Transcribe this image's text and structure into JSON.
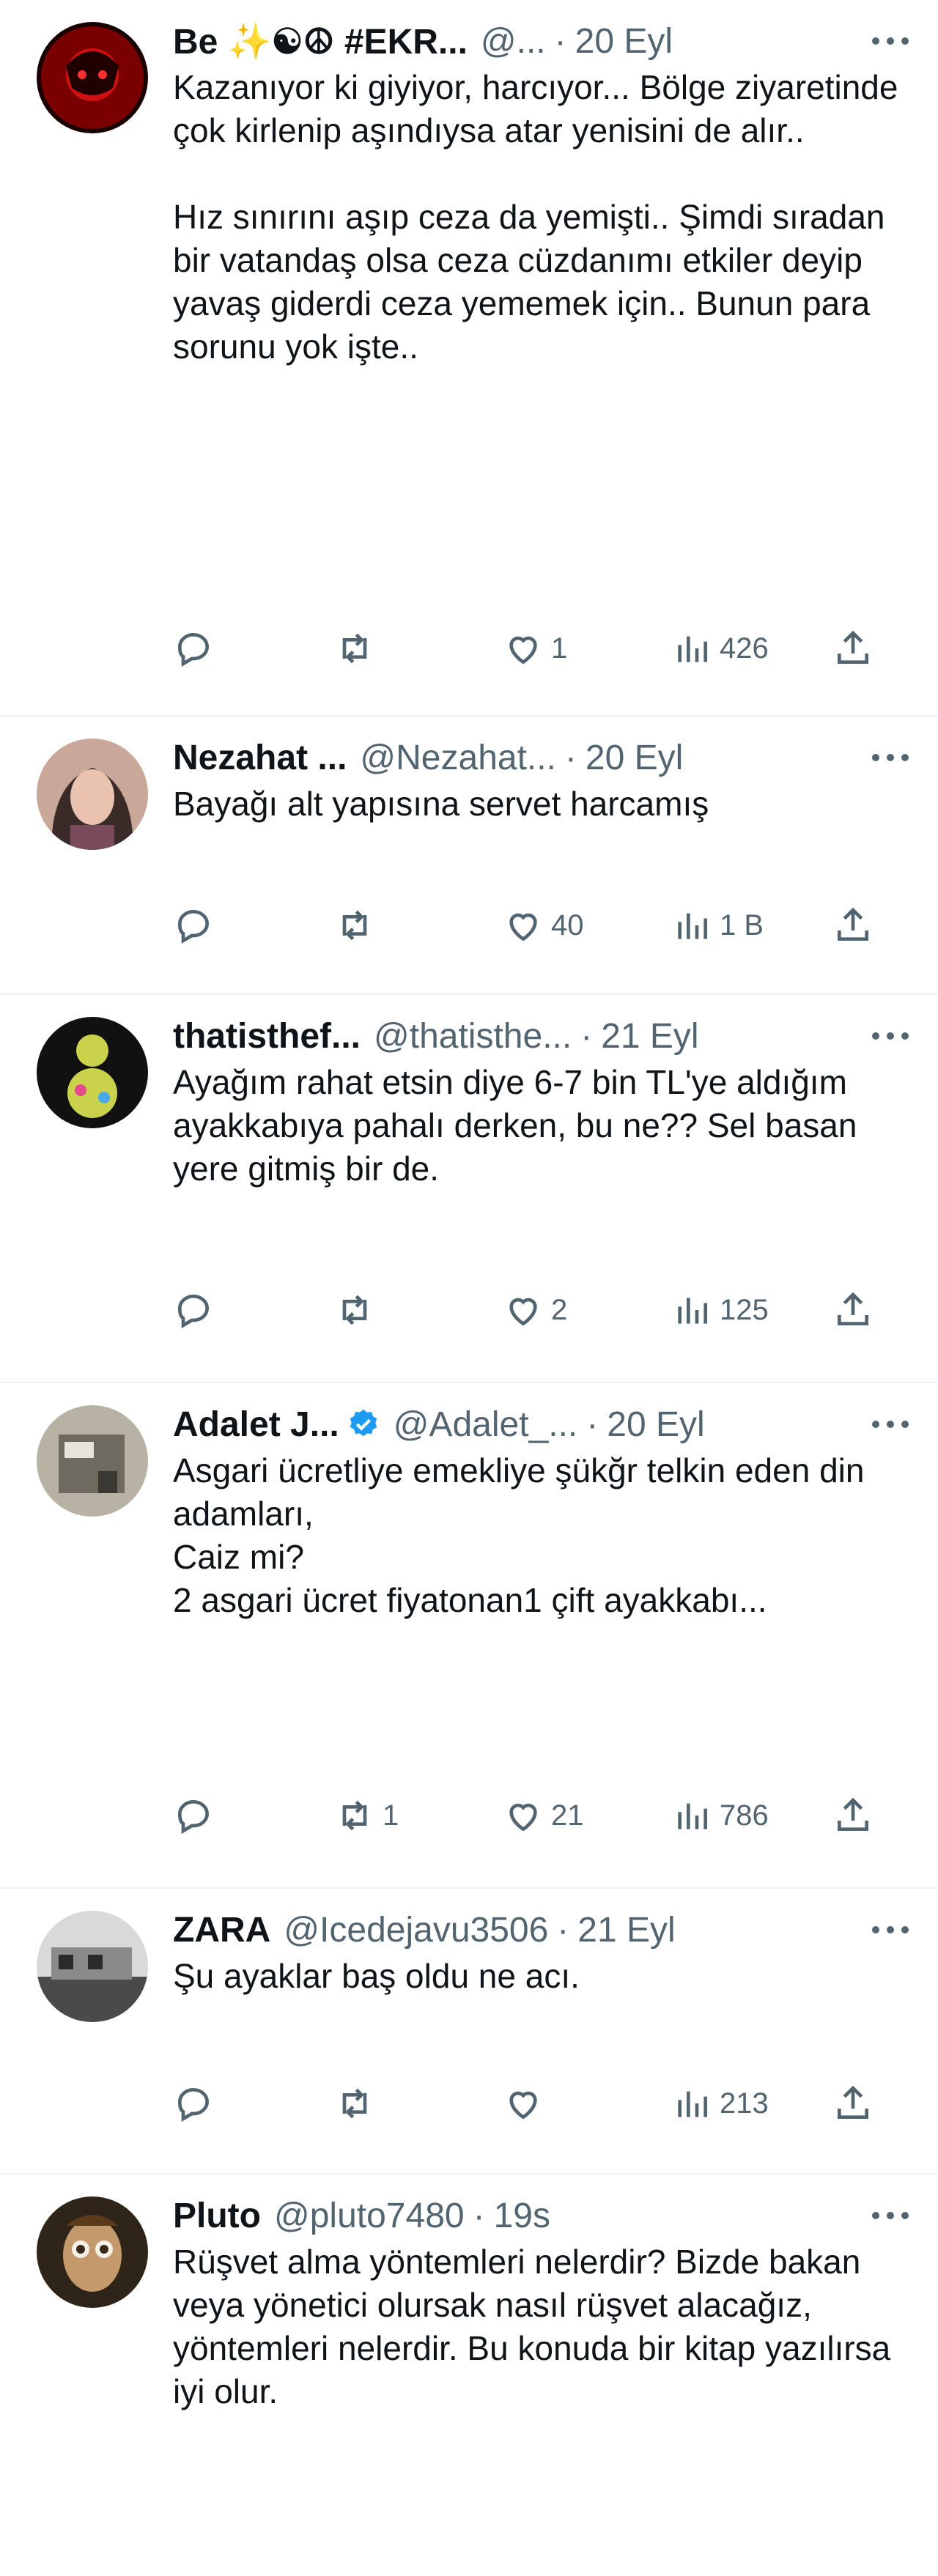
{
  "tweets": [
    {
      "name": "Be ✨☯☮ #EKR...",
      "handle": "@...",
      "time": "20 Eyl",
      "text": "Kazanıyor ki giyiyor, harcıyor... Bölge ziyaretinde çok kirlenip aşındıysa atar yenisini de alır..\n\nHız sınırını aşıp ceza da yemişti.. Şimdi sıradan bir vatandaş olsa ceza cüzdanımı etkiler deyip yavaş giderdi ceza yememek için.. Bunun para sorunu yok işte..",
      "replies": "",
      "retweets": "",
      "likes": "1",
      "views": "426"
    },
    {
      "name": "Nezahat ...",
      "handle": "@Nezahat...",
      "time": "20 Eyl",
      "text": "Bayağı alt yapısına servet harcamış",
      "replies": "",
      "retweets": "",
      "likes": "40",
      "views": "1 B"
    },
    {
      "name": "thatisthef...",
      "handle": "@thatisthe...",
      "time": "21 Eyl",
      "text": "Ayağım rahat etsin diye 6-7 bin TL'ye aldığım ayakkabıya pahalı derken, bu ne?? Sel basan yere gitmiş bir de.",
      "replies": "",
      "retweets": "",
      "likes": "2",
      "views": "125"
    },
    {
      "name": "Adalet J...",
      "handle": "@Adalet_...",
      "time": "20 Eyl",
      "text": "Asgari ücretliye emekliye şükğr telkin eden din adamları,\nCaiz mi?\n2 asgari ücret fiyatonan1 çift ayakkabı...",
      "replies": "",
      "retweets": "1",
      "likes": "21",
      "views": "786"
    },
    {
      "name": "ZARA",
      "handle": "@Icedejavu3506",
      "time": "21 Eyl",
      "text": "Şu ayaklar baş oldu ne acı.",
      "replies": "",
      "retweets": "",
      "likes": "",
      "views": "213"
    },
    {
      "name": "Pluto",
      "handle": "@pluto7480",
      "time": "19s",
      "text": "Rüşvet alma yöntemleri nelerdir? Bizde bakan veya yönetici olursak nasıl rüşvet alacağız, yöntemleri nelerdir. Bu konuda bir kitap yazılırsa iyi olur."
    }
  ],
  "icons": {
    "reply": "reply-icon",
    "retweet": "retweet-icon",
    "like": "like-icon",
    "views": "views-icon",
    "share": "share-icon",
    "verified": "verified-badge-icon",
    "more": "more-icon"
  },
  "colors": {
    "text": "#0f1419",
    "secondary": "#536471",
    "verified": "#1d9bf0",
    "divider": "#eff3f4"
  }
}
